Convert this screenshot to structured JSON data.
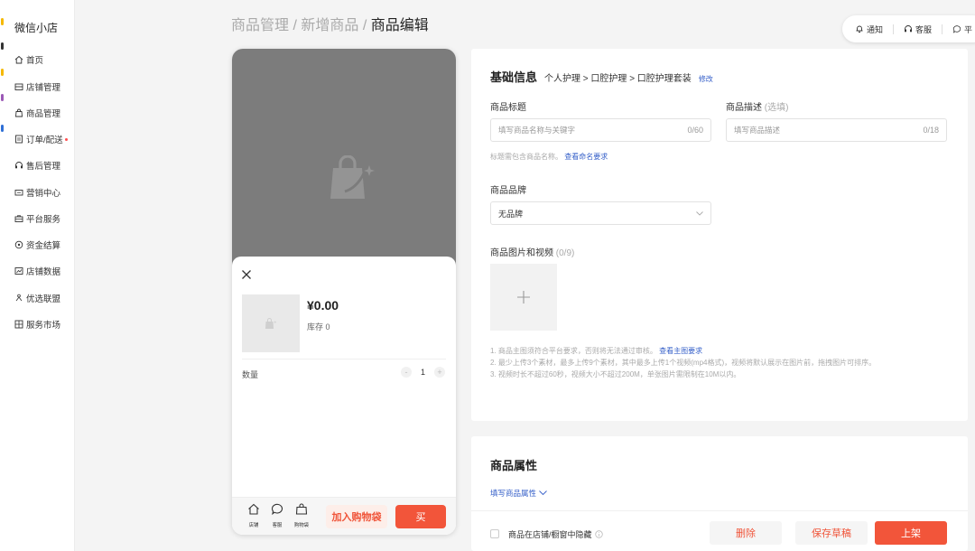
{
  "sidebar": {
    "shop_title": "微信小店",
    "items": [
      {
        "label": "首页",
        "icon": "home-icon"
      },
      {
        "label": "店铺管理",
        "icon": "store-icon"
      },
      {
        "label": "商品管理",
        "icon": "bag-icon"
      },
      {
        "label": "订单/配送",
        "icon": "order-icon",
        "dot": true
      },
      {
        "label": "售后管理",
        "icon": "headset-icon"
      },
      {
        "label": "营销中心",
        "icon": "ticket-icon"
      },
      {
        "label": "平台服务",
        "icon": "briefcase-icon"
      },
      {
        "label": "资金结算",
        "icon": "coin-icon"
      },
      {
        "label": "店铺数据",
        "icon": "chart-icon"
      },
      {
        "label": "优选联盟",
        "icon": "network-icon"
      },
      {
        "label": "服务市场",
        "icon": "grid-icon"
      }
    ]
  },
  "breadcrumb": {
    "part1": "商品管理",
    "sep": " / ",
    "part2": "新增商品",
    "current": "商品编辑"
  },
  "topbar": {
    "notify": "通知",
    "service": "客服",
    "third": "平"
  },
  "preview": {
    "price": "¥0.00",
    "stock": "库存 0",
    "qty_label": "数量",
    "qty_value": "1",
    "minus": "-",
    "plus": "+",
    "bottom_icons": [
      "店铺",
      "客服",
      "购物袋"
    ],
    "add_cart": "加入购物袋",
    "buy": "买"
  },
  "basic": {
    "heading": "基础信息",
    "category_path": "个人护理 > 口腔护理 > 口腔护理套装",
    "edit": "修改",
    "title_label": "商品标题",
    "title_placeholder": "填写商品名称与关键字",
    "title_count": "0/60",
    "desc_label": "商品描述",
    "desc_optional": "(选填)",
    "desc_placeholder": "填写商品描述",
    "desc_count": "0/18",
    "title_hint": "标题需包含商品名称。",
    "title_hint_link": "查看命名要求",
    "brand_label": "商品品牌",
    "brand_value": "无品牌",
    "media_label": "商品图片和视频",
    "media_count": "(0/9)",
    "upload_plus": "+",
    "note1": "1. 商品主图须符合平台要求，否则将无法通过审核。",
    "note1_link": "查看主图要求",
    "note2": "2. 最少上传3个素材，最多上传9个素材，其中最多上传1个视频(mp4格式)，视频将默认展示在图片前，拖拽图片可排序。",
    "note3": "3. 视频时长不超过60秒，视频大小不超过200M，单张图片需限制在10M以内。"
  },
  "attrs": {
    "heading": "商品属性",
    "fill_link": "填写商品属性"
  },
  "footer": {
    "hide_label": "商品在店铺/橱窗中隐藏",
    "delete": "删除",
    "save_draft": "保存草稿",
    "publish": "上架"
  },
  "colors": {
    "accent": "#f2553a",
    "link": "#3660c9"
  }
}
